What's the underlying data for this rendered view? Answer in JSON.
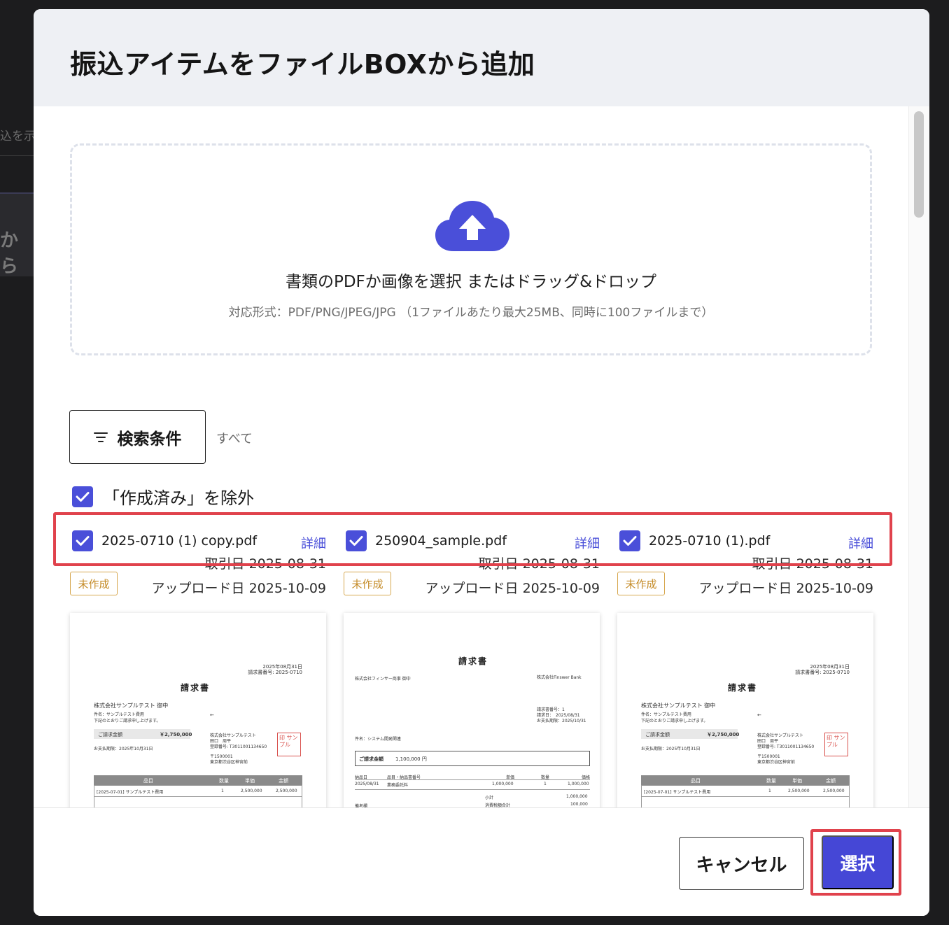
{
  "background": {
    "fragment_top": "込を示",
    "fragment_card": "から"
  },
  "modal": {
    "title": "振込アイテムをファイルBOXから追加"
  },
  "upload": {
    "main_text": "書類のPDFか画像を選択 またはドラッグ&ドロップ",
    "sub_text": "対応形式：PDF/PNG/JPEG/JPG （1ファイルあたり最大25MB、同時に100ファイルまで）",
    "icon": "cloud-upload-icon",
    "accent": "#4a4fd9"
  },
  "search": {
    "button_label": "検索条件",
    "current_filter": "すべて"
  },
  "exclude_created": {
    "label": "「作成済み」を除外",
    "checked": true
  },
  "files": [
    {
      "name": "2025-0710 (1) copy.pdf",
      "checked": true,
      "detail_label": "詳細",
      "status": "未作成",
      "transaction_date": "取引日 2025-08-31",
      "upload_date": "アップロード日 2025-10-09",
      "preview": {
        "date": "2025年08月31日",
        "number": "請求書番号: 2025-0710",
        "title": "請求書",
        "recipient": "株式会社サンプルテスト 御中",
        "subject": "件名：サンプルテスト費用",
        "note": "下記のとおりご請求申し上げます。",
        "amount_label": "ご請求金額",
        "amount": "￥2,750,000",
        "due": "お支払期限：2025年10月31日",
        "issuer": "株式会社サンプルテスト",
        "issuer_person": "田口　周平",
        "issuer_reg": "登録番号: T3011001134650",
        "issuer_zip": "〒1500001",
        "issuer_addr": "東京都渋谷区神宮前",
        "stamp": "印 サンプル",
        "headers": [
          "品目",
          "数量",
          "単価",
          "金額"
        ],
        "row": [
          "[2025-07-01] サンプルテスト費用",
          "1",
          "2,500,000",
          "2,500,000"
        ]
      }
    },
    {
      "name": "250904_sample.pdf",
      "checked": true,
      "detail_label": "詳細",
      "status": "未作成",
      "transaction_date": "取引日 2025-08-31",
      "upload_date": "アップロード日 2025-10-09",
      "preview": {
        "title": "請求書",
        "recipient": "株式会社フィンサー商事 御中",
        "issuer": "株式会社Finswer Bank",
        "number": "請求書番号：1",
        "issue_date": "請求日：　2025/08/31",
        "due": "お支払期限：2025/10/31",
        "subject": "件名：システム開発関連",
        "amount_label": "ご請求金額",
        "amount": "1,100,000 円",
        "headers": [
          "納品日",
          "品目・納品書番号",
          "単価",
          "数量",
          "価格"
        ],
        "row": [
          "2025/08/31",
          "業務委託料",
          "1,000,000",
          "1",
          "1,000,000"
        ],
        "subtotal_label": "小計",
        "subtotal": "1,000,000",
        "tax_label": "消費税額合計",
        "tax": "100,000",
        "extra": "備考欄"
      }
    },
    {
      "name": "2025-0710 (1).pdf",
      "checked": true,
      "detail_label": "詳細",
      "status": "未作成",
      "transaction_date": "取引日 2025-08-31",
      "upload_date": "アップロード日 2025-10-09",
      "preview": {
        "date": "2025年08月31日",
        "number": "請求書番号: 2025-0710",
        "title": "請求書",
        "recipient": "株式会社サンプルテスト 御中",
        "subject": "件名：サンプルテスト費用",
        "note": "下記のとおりご請求申し上げます。",
        "amount_label": "ご請求金額",
        "amount": "￥2,750,000",
        "due": "お支払期限：2025年10月31日",
        "issuer": "株式会社サンプルテスト",
        "issuer_person": "田口　周平",
        "issuer_reg": "登録番号: T3011001134650",
        "issuer_zip": "〒1500001",
        "issuer_addr": "東京都渋谷区神宮前",
        "stamp": "印 サンプル",
        "headers": [
          "品目",
          "数量",
          "単価",
          "金額"
        ],
        "row": [
          "[2025-07-01] サンプルテスト費用",
          "1",
          "2,500,000",
          "2,500,000"
        ]
      }
    }
  ],
  "footer": {
    "cancel_label": "キャンセル",
    "select_label": "選択"
  },
  "colors": {
    "primary": "#4547d6",
    "highlight": "#e0424c",
    "badge": "#c48a25"
  }
}
